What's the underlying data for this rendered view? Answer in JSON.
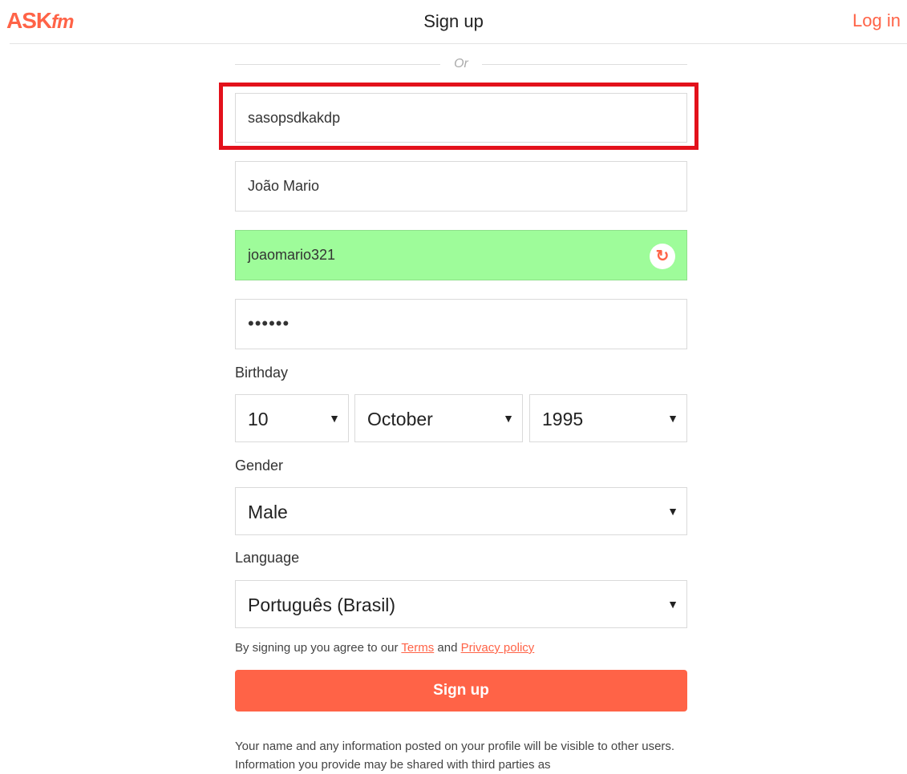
{
  "header": {
    "logo_main": "ASK",
    "logo_suffix": "fm",
    "title": "Sign up",
    "login_label": "Log in"
  },
  "divider": {
    "or_label": "Or"
  },
  "form": {
    "email_value": "sasopsdkakdp",
    "name_value": "João Mario",
    "username_value": "joaomario321",
    "password_masked": "••••••",
    "birthday_label": "Birthday",
    "birthday_day": "10",
    "birthday_month": "October",
    "birthday_year": "1995",
    "gender_label": "Gender",
    "gender_value": "Male",
    "language_label": "Language",
    "language_value": "Português (Brasil)"
  },
  "terms": {
    "prefix": "By signing up you agree to our ",
    "terms_link": "Terms",
    "middle": " and ",
    "privacy_link": "Privacy policy"
  },
  "signup_button": "Sign up",
  "disclaimer": "Your name and any information posted on your profile will be visible to other users. Information you provide may be shared with third parties as",
  "colors": {
    "brand": "#ff6347",
    "valid_field": "#9efc9a",
    "highlight": "#e3111b"
  },
  "icons": {
    "refresh": "refresh-icon",
    "dropdown": "caret-down-icon"
  }
}
